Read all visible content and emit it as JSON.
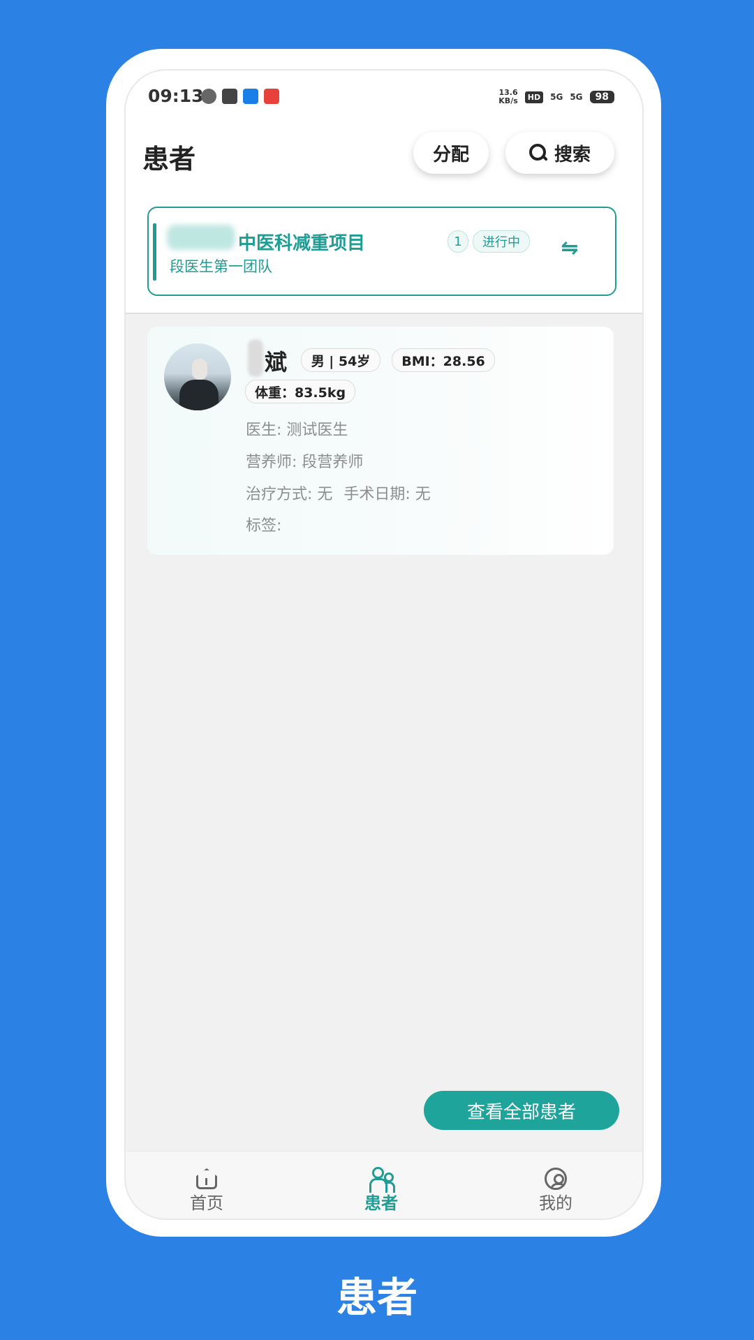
{
  "status_bar": {
    "time": "09:13",
    "net_speed_value": "13.6",
    "net_speed_unit": "KB/s",
    "hd": "HD",
    "signal1": "5G",
    "signal2": "5G",
    "battery": "98"
  },
  "header": {
    "title": "患者",
    "assign_label": "分配",
    "search_label": "搜索"
  },
  "project": {
    "name": "中医科减重项目",
    "team": "段医生第一团队",
    "count": "1",
    "status": "进行中"
  },
  "patient": {
    "name": "斌",
    "gender_age": "男 | 54岁",
    "bmi": "BMI：28.56",
    "weight": "体重：83.5kg",
    "doctor": "医生: 测试医生",
    "nutritionist": "营养师: 段营养师",
    "treatment": "治疗方式: 无",
    "surgery_date": "手术日期: 无",
    "tags": "标签:"
  },
  "view_all_label": "查看全部患者",
  "bottom_nav": {
    "home": "首页",
    "patients": "患者",
    "mine": "我的"
  },
  "caption": "患者",
  "colors": {
    "accent": "#1f9c94",
    "background": "#2b82e4"
  }
}
